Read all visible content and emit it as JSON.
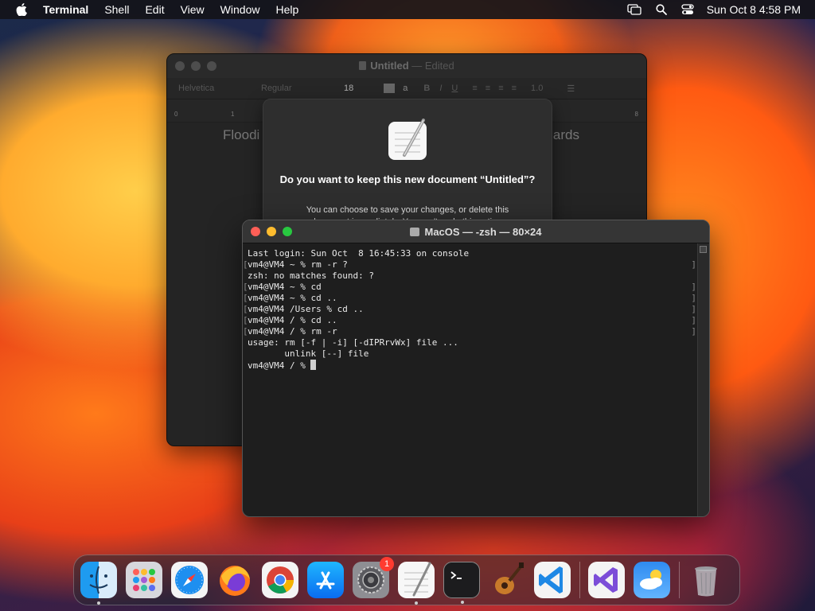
{
  "menubar": {
    "app_name": "Terminal",
    "items": [
      "Shell",
      "Edit",
      "View",
      "Window",
      "Help"
    ],
    "clock": "Sun Oct 8  4:58 PM"
  },
  "textedit": {
    "title": "Untitled",
    "edited": " — Edited",
    "font": "Helvetica",
    "style": "Regular",
    "size": "18",
    "spacing": "1.0",
    "ruler": [
      "0",
      "1",
      "8"
    ],
    "doc_text_left": "Floodi",
    "doc_text_right": "ards"
  },
  "sheet": {
    "question": "Do you want to keep this new document “Untitled”?",
    "info": "You can choose to save your changes, or delete this document immediately. You can't undo this action."
  },
  "terminal": {
    "title": "MacOS — -zsh — 80×24",
    "lines": [
      {
        "text": "Last login: Sun Oct  8 16:45:33 on console",
        "marked": false
      },
      {
        "text": "vm4@VM4 ~ % rm -r ?",
        "marked": true
      },
      {
        "text": "zsh: no matches found: ?",
        "marked": false
      },
      {
        "text": "vm4@VM4 ~ % cd",
        "marked": true
      },
      {
        "text": "vm4@VM4 ~ % cd ..",
        "marked": true
      },
      {
        "text": "vm4@VM4 /Users % cd ..",
        "marked": true
      },
      {
        "text": "vm4@VM4 / % cd ..",
        "marked": true
      },
      {
        "text": "vm4@VM4 / % rm -r",
        "marked": true
      },
      {
        "text": "usage: rm [-f | -i] [-dIPRrvWx] file ...",
        "marked": false
      },
      {
        "text": "       unlink [--] file",
        "marked": false
      }
    ],
    "prompt": "vm4@VM4 / % "
  },
  "dock": {
    "icons": [
      "finder-icon",
      "launchpad-icon",
      "safari-icon",
      "firefox-icon",
      "chrome-icon",
      "app-store-icon",
      "system-settings-icon",
      "textedit-icon",
      "terminal-icon",
      "garageband-icon",
      "vscode-icon",
      "visual-studio-icon",
      "weather-icon",
      "trash-icon"
    ],
    "settings_badge": "1"
  }
}
